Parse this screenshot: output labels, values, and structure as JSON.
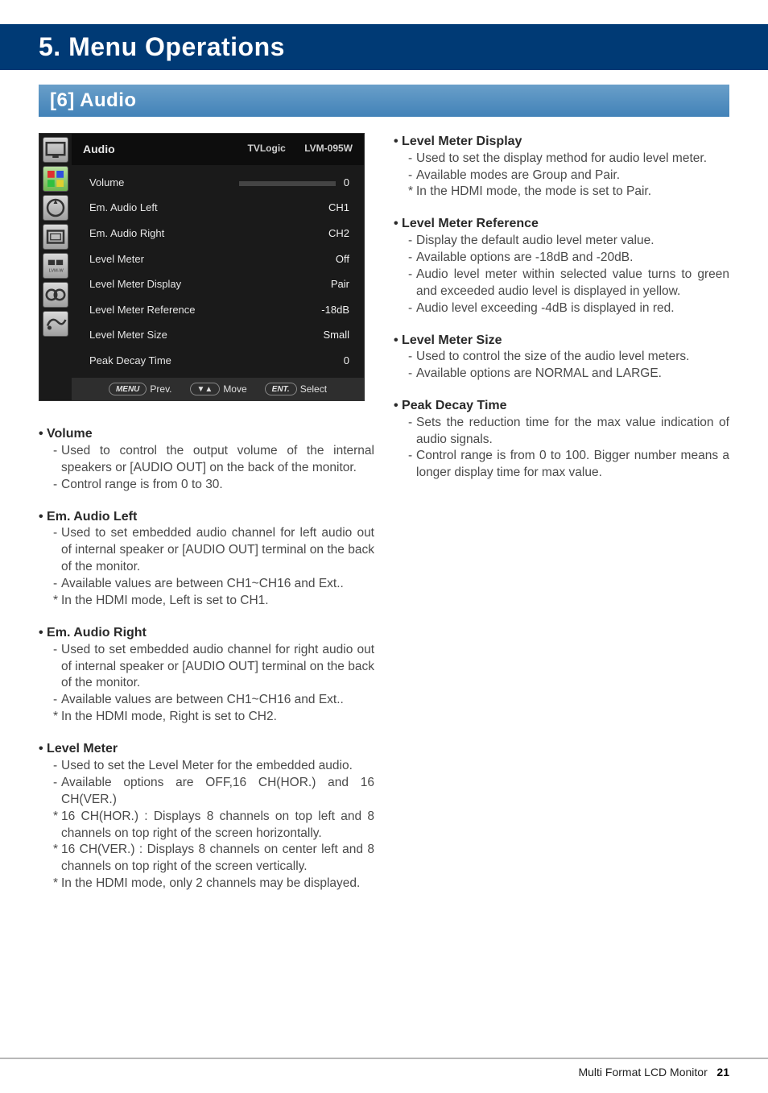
{
  "chapter": "5. Menu Operations",
  "section": "[6] Audio",
  "menu": {
    "title": "Audio",
    "brand": "TVLogic",
    "model": "LVM-095W",
    "rows": [
      {
        "label": "Volume",
        "value": "0",
        "slider": true
      },
      {
        "label": "Em. Audio Left",
        "value": "CH1"
      },
      {
        "label": "Em. Audio Right",
        "value": "CH2"
      },
      {
        "label": "Level Meter",
        "value": "Off"
      },
      {
        "label": "Level Meter Display",
        "value": "Pair"
      },
      {
        "label": "Level Meter Reference",
        "value": "-18dB"
      },
      {
        "label": "Level Meter Size",
        "value": "Small"
      },
      {
        "label": "Peak Decay Time",
        "value": "0"
      }
    ],
    "buttons": {
      "prev_pill": "MENU",
      "prev": "Prev.",
      "move_pill": "▼▲",
      "move": "Move",
      "select_pill": "ENT.",
      "select": "Select"
    }
  },
  "left_items": [
    {
      "title": "Volume",
      "subs": [
        "Used to control the output volume of the internal speakers or [AUDIO OUT] on the back of the monitor.",
        "Control range is from 0 to 30."
      ],
      "notes": []
    },
    {
      "title": "Em. Audio Left",
      "subs": [
        "Used to set embedded audio channel for left audio out of internal speaker or [AUDIO OUT] terminal on the back of the monitor.",
        "Available values are between CH1~CH16 and Ext.."
      ],
      "notes": [
        "In the HDMI mode, Left is set to CH1."
      ]
    },
    {
      "title": "Em. Audio Right",
      "subs": [
        "Used to set embedded audio channel for right audio out of internal speaker or [AUDIO OUT] terminal on the back of the monitor.",
        "Available values are between CH1~CH16 and Ext.."
      ],
      "notes": [
        "In the HDMI mode, Right is set to CH2."
      ]
    },
    {
      "title": "Level Meter",
      "subs": [
        "Used to set the Level Meter for the embedded audio.",
        "Available options are OFF,16 CH(HOR.) and 16 CH(VER.)"
      ],
      "notes": [
        "16 CH(HOR.) : Displays 8 channels on top left and 8 channels on top right of the screen horizontally.",
        "16 CH(VER.) : Displays 8 channels on center left and 8 channels on top right of the screen vertically.",
        "In the HDMI mode, only 2 channels may be displayed."
      ]
    }
  ],
  "right_items": [
    {
      "title": "Level Meter Display",
      "subs": [
        "Used to set the display method for audio level meter.",
        "Available modes are Group and Pair."
      ],
      "notes": [
        "In the HDMI mode, the mode is set to Pair."
      ]
    },
    {
      "title": "Level Meter Reference",
      "subs": [
        "Display the default audio level meter value.",
        "Available options are -18dB and -20dB.",
        "Audio level meter within selected value turns to green and exceeded audio level is displayed in yellow.",
        "Audio level exceeding -4dB is displayed in red."
      ],
      "notes": []
    },
    {
      "title": "Level Meter Size",
      "subs": [
        "Used to control the size of the audio level meters.",
        "Available options are NORMAL and LARGE."
      ],
      "notes": []
    },
    {
      "title": "Peak Decay Time",
      "subs": [
        "Sets the reduction time for the max value indication of audio signals.",
        "Control range is from 0 to 100. Bigger number means a longer display time for max value."
      ],
      "notes": []
    }
  ],
  "footer": {
    "label": "Multi Format LCD Monitor",
    "page": "21"
  }
}
